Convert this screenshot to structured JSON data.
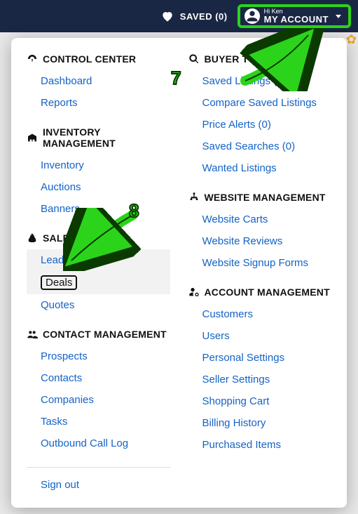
{
  "topbar": {
    "saved_label": "SAVED (0)",
    "greeting": "Hi Ken",
    "account_label": "MY ACCOUNT"
  },
  "sections": {
    "control_center": {
      "title": "CONTROL CENTER",
      "items": [
        "Dashboard",
        "Reports"
      ]
    },
    "inventory_management": {
      "title": "INVENTORY MANAGEMENT",
      "items": [
        "Inventory",
        "Auctions",
        "Banners"
      ]
    },
    "sales_desk": {
      "title": "SALES DESK",
      "items": [
        "Lead Activity",
        "Deals",
        "Quotes"
      ]
    },
    "contact_management": {
      "title": "CONTACT MANAGEMENT",
      "items": [
        "Prospects",
        "Contacts",
        "Companies",
        "Tasks",
        "Outbound Call Log"
      ]
    },
    "buyer_tools": {
      "title": "BUYER TOOLS",
      "items": [
        "Saved Listings (0)",
        "Compare Saved Listings",
        "Price Alerts (0)",
        "Saved Searches (0)",
        "Wanted Listings"
      ]
    },
    "website_management": {
      "title": "WEBSITE MANAGEMENT",
      "items": [
        "Website Carts",
        "Website Reviews",
        "Website Signup Forms"
      ]
    },
    "account_management": {
      "title": "ACCOUNT MANAGEMENT",
      "items": [
        "Customers",
        "Users",
        "Personal Settings",
        "Seller Settings",
        "Shopping Cart",
        "Billing History",
        "Purchased Items"
      ]
    }
  },
  "signout": "Sign out",
  "annotations": {
    "step7": "7",
    "step8": "8"
  }
}
